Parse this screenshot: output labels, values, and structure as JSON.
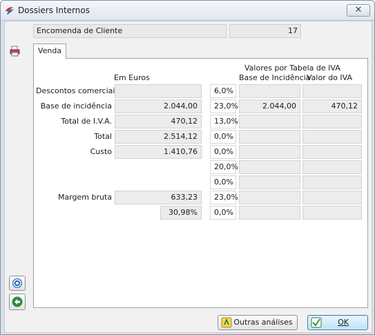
{
  "window": {
    "title": "Dossiers Internos",
    "close_label": "✕"
  },
  "header": {
    "document_type": "Encomenda de Cliente",
    "count": "17"
  },
  "tabs": [
    {
      "label": "Venda"
    }
  ],
  "panel": {
    "euros_header": "Em Euros",
    "vat_group_header": "Valores por Tabela de IVA",
    "base_header": "Base de Incidência",
    "vat_value_header": "Valor do IVA",
    "rows": [
      {
        "label": "Descontos comerciais",
        "value": "",
        "rate": "6,0%",
        "base": "",
        "vat": ""
      },
      {
        "label": "Base de incidência",
        "value": "2.044,00",
        "rate": "23,0%",
        "base": "2.044,00",
        "vat": "470,12"
      },
      {
        "label": "Total de I.V.A.",
        "value": "470,12",
        "rate": "13,0%",
        "base": "",
        "vat": ""
      },
      {
        "label": "Total",
        "value": "2.514,12",
        "rate": "0,0%",
        "base": "",
        "vat": ""
      },
      {
        "label": "Custo",
        "value": "1.410,76",
        "rate": "0,0%",
        "base": "",
        "vat": ""
      },
      {
        "label": "",
        "value": null,
        "rate": "20,0%",
        "base": "",
        "vat": ""
      },
      {
        "label": "",
        "value": null,
        "rate": "0,0%",
        "base": "",
        "vat": ""
      },
      {
        "label": "Margem bruta",
        "value": "633,23",
        "rate": "23,0%",
        "base": "",
        "vat": ""
      },
      {
        "label": "",
        "value": "30,98%",
        "rate": "0,0%",
        "base": "",
        "vat": ""
      }
    ]
  },
  "buttons": {
    "other_analyses": "Outras análises",
    "ok": "OK"
  },
  "icons": {
    "side_top": "printer-icon",
    "help": "help-icon",
    "back": "back-arrow-icon",
    "app": "app-logo-icon"
  }
}
